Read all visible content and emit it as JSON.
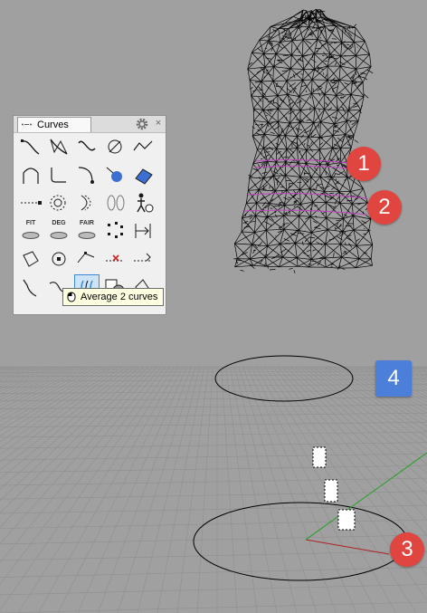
{
  "panel": {
    "tab_label": "Curves",
    "tooltip": "Average 2 curves",
    "tools": [
      [
        "control-point-curve-icon",
        "curve-through-points-icon",
        "interpolate-curve-icon",
        "sketch-curve-icon",
        "polyline-icon"
      ],
      [
        "arc-curve-icon",
        "curve-fillet-icon",
        "blend-curve-icon",
        "curve-from-objects-icon",
        "unroll-icon"
      ],
      [
        "line-extend-icon",
        "circle-from-curve-icon",
        "offset-curve-icon",
        "cross-section-icon",
        "pedestrian-icon"
      ],
      [
        "fit-curve-icon",
        "change-degree-icon",
        "fair-curve-icon",
        "rebuild-points-icon",
        "match-curve-icon"
      ],
      [
        "curve-boolean-icon",
        "circle-point-icon",
        "curve-edit-icon",
        "remove-knot-icon",
        "insert-knot-icon"
      ],
      [
        "extend-curve-icon",
        "connect-curve-icon",
        "average-curves-icon",
        "curve-region-icon",
        "offset-polyline-icon"
      ]
    ],
    "tool_text": {
      "3_0": "FIT",
      "3_1": "DEG",
      "3_2": "FAIR"
    },
    "active_tool": "average-curves-icon"
  },
  "badges": {
    "one": "1",
    "two": "2",
    "three": "3",
    "four": "4"
  },
  "colors": {
    "viewport_bg": "#a0a0a0",
    "grid_line": "#8f8f8f",
    "mesh": "#000000",
    "section_curve": "#c040c0",
    "badge_red": "#e0453f",
    "badge_blue": "#4c7fd9",
    "axis_x": "#b02020",
    "axis_y": "#20a020"
  }
}
